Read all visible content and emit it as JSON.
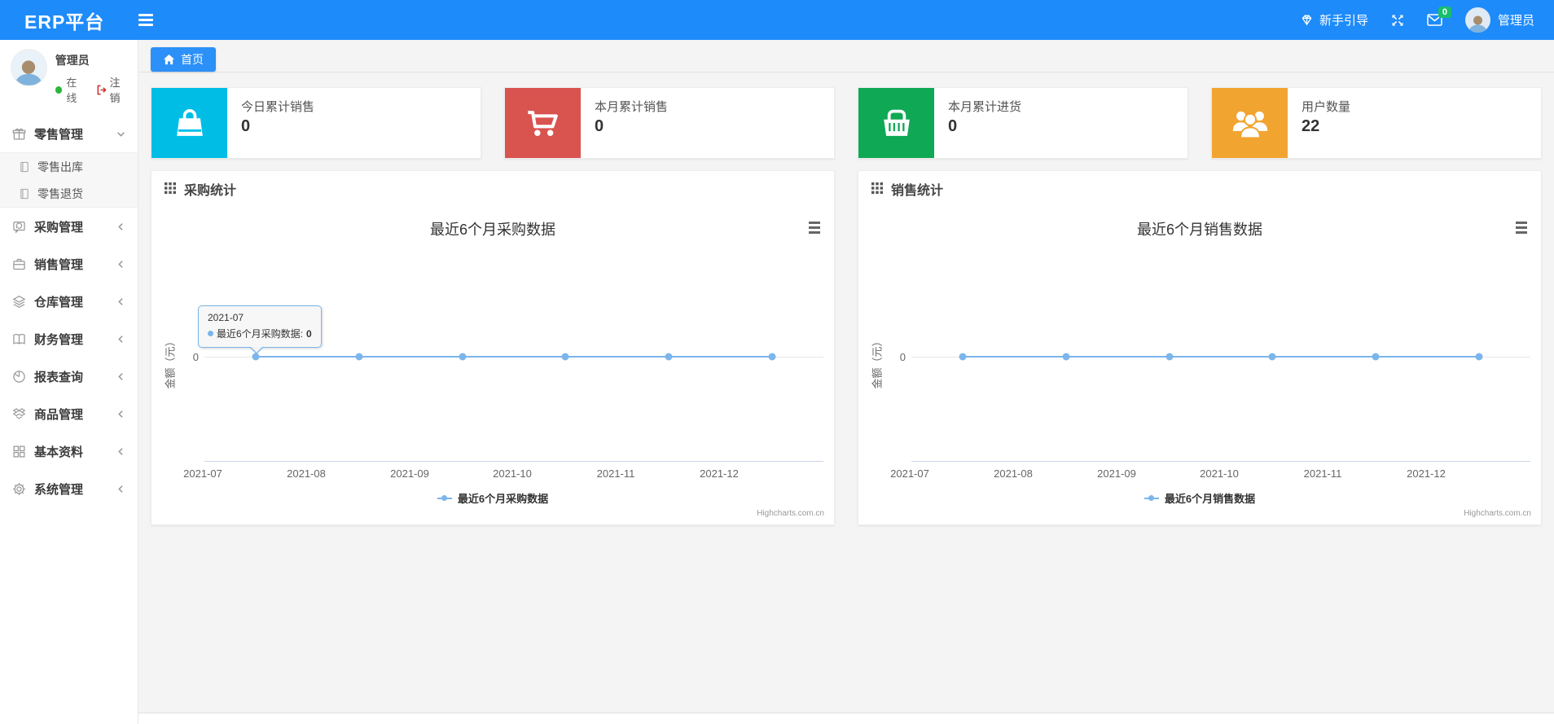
{
  "colors": {
    "navbar": "#1e8bfb",
    "series": "#7cb5ec",
    "badge": "#19be6b",
    "card_cyan": "#00bde6",
    "card_red": "#d9534f",
    "card_green": "#0fa854",
    "card_orange": "#f2a430"
  },
  "navbar": {
    "brand": "ERP平台",
    "guide_label": "新手引导",
    "message_badge": "0",
    "username": "管理员"
  },
  "sidebar": {
    "user": {
      "name": "管理员",
      "status": "在线",
      "logout": "注销"
    },
    "menu": [
      {
        "label": "零售管理",
        "icon": "gift-icon",
        "expanded": true,
        "children": [
          "零售出库",
          "零售退货"
        ]
      },
      {
        "label": "采购管理",
        "icon": "purchase-icon"
      },
      {
        "label": "销售管理",
        "icon": "briefcase-icon"
      },
      {
        "label": "仓库管理",
        "icon": "layers-icon"
      },
      {
        "label": "财务管理",
        "icon": "book-icon"
      },
      {
        "label": "报表查询",
        "icon": "pie-chart-icon"
      },
      {
        "label": "商品管理",
        "icon": "box-icon"
      },
      {
        "label": "基本资料",
        "icon": "grid-icon"
      },
      {
        "label": "系统管理",
        "icon": "gear-icon"
      }
    ]
  },
  "tabs": {
    "home": "首页"
  },
  "stat_cards": [
    {
      "label": "今日累计销售",
      "value": "0",
      "color": "#00bde6",
      "icon": "bag-icon"
    },
    {
      "label": "本月累计销售",
      "value": "0",
      "color": "#d9534f",
      "icon": "cart-icon"
    },
    {
      "label": "本月累计进货",
      "value": "0",
      "color": "#0fa854",
      "icon": "basket-icon"
    },
    {
      "label": "用户数量",
      "value": "22",
      "color": "#f2a430",
      "icon": "users-icon"
    }
  ],
  "panels": [
    {
      "title": "采购统计"
    },
    {
      "title": "销售统计"
    }
  ],
  "chart_data": [
    {
      "type": "line",
      "title": "最近6个月采购数据",
      "x": [
        "2021-07",
        "2021-08",
        "2021-09",
        "2021-10",
        "2021-11",
        "2021-12"
      ],
      "series": [
        {
          "name": "最近6个月采购数据",
          "values": [
            0,
            0,
            0,
            0,
            0,
            0
          ],
          "color": "#7cb5ec"
        }
      ],
      "ylabel": "金额（元）",
      "ytick": "0",
      "ylim": [
        -1,
        1
      ],
      "grid": true,
      "legend_position": "bottom"
    },
    {
      "type": "line",
      "title": "最近6个月销售数据",
      "x": [
        "2021-07",
        "2021-08",
        "2021-09",
        "2021-10",
        "2021-11",
        "2021-12"
      ],
      "series": [
        {
          "name": "最近6个月销售数据",
          "values": [
            0,
            0,
            0,
            0,
            0,
            0
          ],
          "color": "#7cb5ec"
        }
      ],
      "ylabel": "金额（元）",
      "ytick": "0",
      "ylim": [
        -1,
        1
      ],
      "grid": true,
      "legend_position": "bottom"
    }
  ],
  "tooltip": {
    "title": "2021-07",
    "label": "最近6个月采购数据:",
    "value": "0"
  },
  "credit": "Highcharts.com.cn"
}
